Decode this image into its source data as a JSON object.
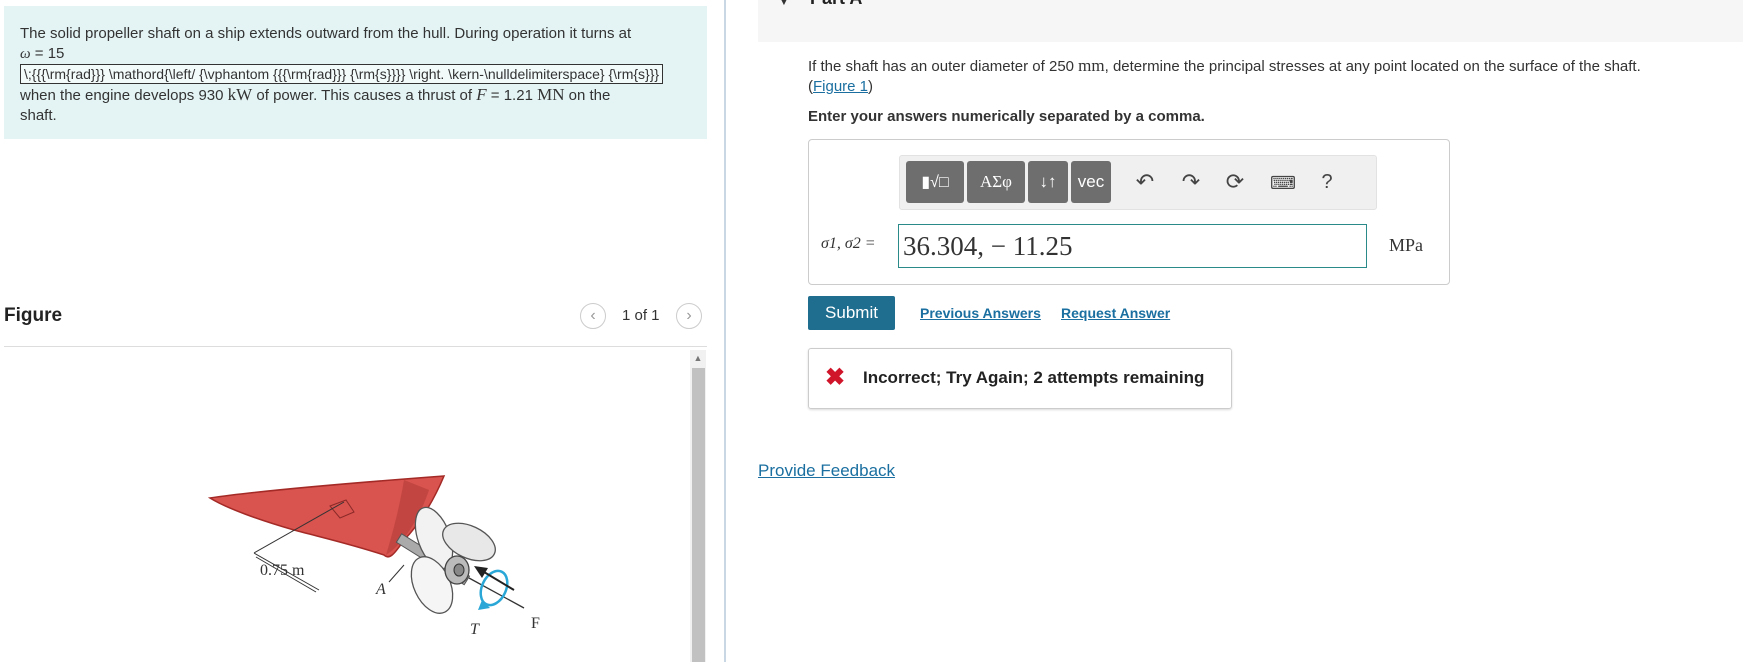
{
  "problem": {
    "line1": "The solid propeller shaft on a ship extends outward from the hull. During operation it turns at",
    "omega_symbol": "ω",
    "omega_eq": " = 15",
    "latex_error": "\\;{{{\\rm{rad}}} \\mathord{\\left/ {\\vphantom {{{\\rm{rad}}} {\\rm{s}}}} \\right. \\kern-\\nulldelimiterspace} {\\rm{s}}}",
    "line3a": "when the engine develops 930 ",
    "power_unit": "kW",
    "line3b": " of power. This causes a thrust of ",
    "force_symbol": "F",
    "line3c": " = 1.21 ",
    "force_unit": "MN",
    "line3d": " on the",
    "line4": "shaft."
  },
  "figure": {
    "title": "Figure",
    "pager": "1 of 1",
    "prev_icon": "chevron-left-icon",
    "next_icon": "chevron-right-icon",
    "dim_label": "0.75 m",
    "point_label": "A",
    "torque_label": "T",
    "force_label": "F",
    "colors": {
      "hull": "#d9534f",
      "hull_dark": "#a32a26",
      "arrow": "#2aa7d6"
    }
  },
  "part": {
    "label": "Part A",
    "collapse_icon": "chevron-down-icon"
  },
  "question": {
    "text_a": "If the shaft has an outer diameter of 250 ",
    "unit": "mm",
    "text_b": ", determine the principal stresses at any point located on the surface of the shaft.",
    "figure_link": "Figure 1"
  },
  "instruction": "Enter your answers numerically separated by a comma.",
  "toolbar": {
    "templates_icon": "templates-icon",
    "symbols_label": "ΑΣφ",
    "arrows_label": "↓↑",
    "vec_label": "vec",
    "undo_icon": "undo-icon",
    "redo_icon": "redo-icon",
    "reset_icon": "reset-icon",
    "keyboard_icon": "keyboard-icon",
    "help_label": "?"
  },
  "answer": {
    "label": "σ1, σ2 =",
    "value": "36.304, − 11.25",
    "unit": "MPa"
  },
  "actions": {
    "submit": "Submit",
    "previous_answers": "Previous Answers",
    "request_answer": "Request Answer"
  },
  "feedback": {
    "icon": "x-mark-icon",
    "text": "Incorrect; Try Again; 2 attempts remaining",
    "color": "#d0142a"
  },
  "provide_feedback": "Provide Feedback"
}
